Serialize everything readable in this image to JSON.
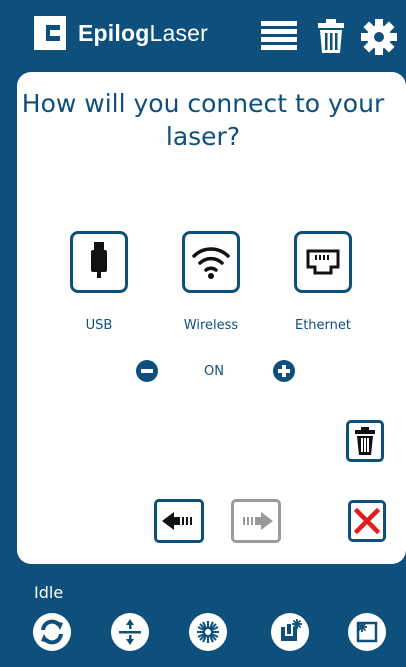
{
  "header": {
    "brand_bold": "Epilog",
    "brand_light": "Laser",
    "icons": [
      "logo-icon",
      "list-icon",
      "trash-icon",
      "gear-icon"
    ]
  },
  "main": {
    "question": "How will you connect to your laser?",
    "connections": [
      {
        "label": "USB",
        "icon": "usb-icon"
      },
      {
        "label": "Wireless",
        "icon": "wifi-icon"
      },
      {
        "label": "Ethernet",
        "icon": "ethernet-icon"
      }
    ],
    "toggle_state": "ON",
    "controls": [
      "minus-icon",
      "plus-icon",
      "delete-icon",
      "back-arrow-icon",
      "forward-arrow-icon",
      "close-icon"
    ]
  },
  "status": {
    "text": "Idle",
    "icons": [
      "refresh-icon",
      "focus-icon",
      "laser-star-icon",
      "job-icon",
      "home-corner-icon"
    ]
  },
  "colors": {
    "brand": "#0e4f7c",
    "panel": "#ffffff",
    "disabled": "#9a9a9a",
    "danger": "#e21b1b"
  }
}
